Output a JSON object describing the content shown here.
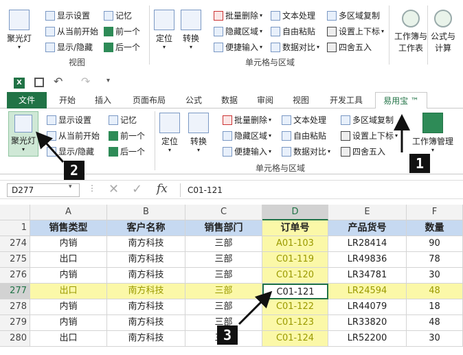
{
  "top_ribbon": {
    "big_left": "聚光灯",
    "col1": [
      "显示设置",
      "从当前开始",
      "显示/隐藏"
    ],
    "col2": [
      "记忆",
      "前一个",
      "后一个"
    ],
    "group1_label": "视图",
    "big_locate": "定位",
    "big_convert": "转换",
    "col3": [
      "批量删除",
      "隐藏区域",
      "便捷输入"
    ],
    "col4": [
      "文本处理",
      "自由粘贴",
      "数据对比"
    ],
    "col5": [
      "多区域复制",
      "设置上下标",
      "四舍五入"
    ],
    "group2_label": "单元格与区域",
    "wb_btn": [
      "工作簿与",
      "工作表"
    ],
    "formula_btn": [
      "公式与",
      "计算"
    ]
  },
  "window": {
    "tabs": [
      "文件",
      "开始",
      "插入",
      "页面布局",
      "公式",
      "数据",
      "审阅",
      "视图",
      "开发工具",
      "易用宝 ™"
    ],
    "ribbon": {
      "big_left": "聚光灯",
      "col1": [
        "显示设置",
        "从当前开始",
        "显示/隐藏"
      ],
      "col2": [
        "记忆",
        "前一个",
        "后一个"
      ],
      "big_locate": "定位",
      "big_convert": "转换",
      "col3": [
        "批量删除",
        "隐藏区域",
        "便捷输入"
      ],
      "col4": [
        "文本处理",
        "自由粘贴",
        "数据对比"
      ],
      "col5": [
        "多区域复制",
        "设置上下标",
        "四舍五入"
      ],
      "group_label": "单元格与区域",
      "wb_btn": "工作簿管理"
    },
    "name_box": "D277",
    "formula": "C01-121",
    "fx": "fx"
  },
  "grid": {
    "columns": [
      "A",
      "B",
      "C",
      "D",
      "E",
      "F"
    ],
    "header_row_num": "1",
    "headers": [
      "销售类型",
      "客户名称",
      "销售部门",
      "订单号",
      "产品货号",
      "数量"
    ],
    "rows": [
      {
        "num": "274",
        "cells": [
          "内销",
          "南方科技",
          "三部",
          "A01-103",
          "LR28414",
          "90"
        ]
      },
      {
        "num": "275",
        "cells": [
          "出口",
          "南方科技",
          "三部",
          "C01-119",
          "LR49836",
          "78"
        ]
      },
      {
        "num": "276",
        "cells": [
          "内销",
          "南方科技",
          "三部",
          "C01-120",
          "LR34781",
          "30"
        ]
      },
      {
        "num": "277",
        "cells": [
          "出口",
          "南方科技",
          "三部",
          "C01-121",
          "LR24594",
          "48"
        ]
      },
      {
        "num": "278",
        "cells": [
          "内销",
          "南方科技",
          "三部",
          "C01-122",
          "LR44079",
          "18"
        ]
      },
      {
        "num": "279",
        "cells": [
          "内销",
          "南方科技",
          "三部",
          "C01-123",
          "LR33820",
          "48"
        ]
      },
      {
        "num": "280",
        "cells": [
          "出口",
          "南方科技",
          "三部",
          "C01-124",
          "LR52200",
          "30"
        ]
      }
    ]
  },
  "callouts": [
    "1",
    "2",
    "3"
  ],
  "colors": {
    "excel_green": "#217346",
    "highlight": "#fbf8a8",
    "header_fill": "#c6d9f1"
  }
}
